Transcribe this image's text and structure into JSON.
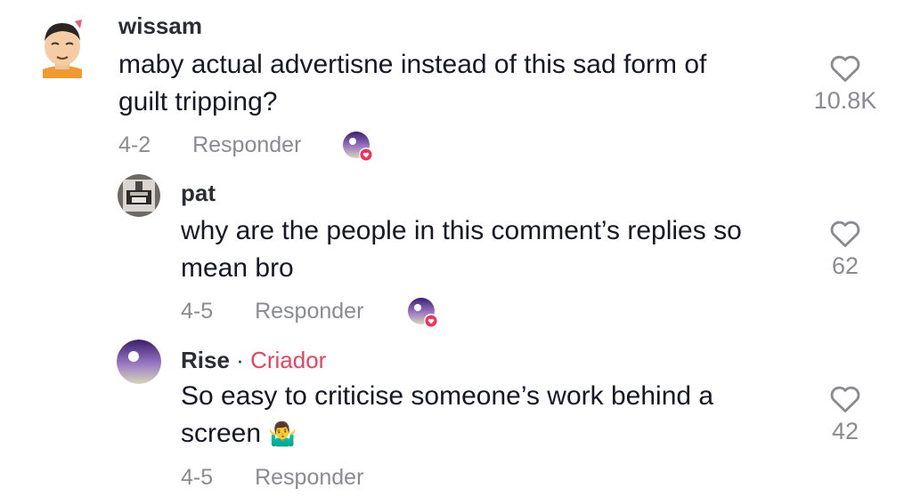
{
  "comments": [
    {
      "username": "wissam",
      "text_line1": "maby actual advertisne instead of this sad form of",
      "text_line2": "guilt tripping?",
      "date": "4-2",
      "reply_label": "Responder",
      "likes": "10.8K"
    },
    {
      "username": "pat",
      "text_line1": "why are the people in this comment’s replies so",
      "text_line2": "mean bro",
      "date": "4-5",
      "reply_label": "Responder",
      "likes": "62"
    },
    {
      "username": "Rise",
      "separator": "·",
      "badge": "Criador",
      "text_line1": "So easy to criticise someone’s work behind a",
      "text_line2": "screen",
      "emoji": "🤷‍♂️",
      "date": "4-5",
      "reply_label": "Responder",
      "likes": "42"
    }
  ],
  "icons": {
    "like": "heart-outline-icon",
    "creator_liked": "creator-liked-avatar-icon",
    "heart_badge": "heart-icon"
  },
  "colors": {
    "creator_badge": "#e8435e",
    "meta_text": "#8a8b91",
    "heart_badge": "#fe2c55"
  }
}
